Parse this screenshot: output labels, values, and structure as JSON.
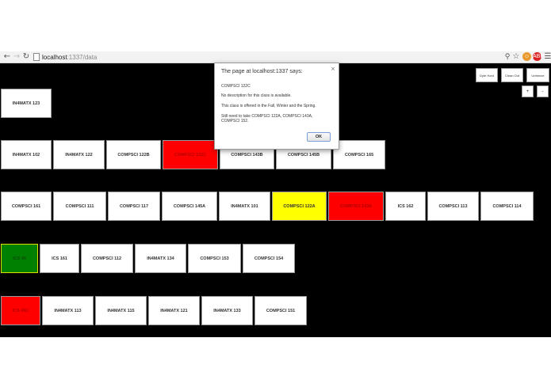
{
  "browser": {
    "url_host": "localhost",
    "url_rest": ":1337/data",
    "icons": [
      "back-icon",
      "forward-icon",
      "reload-icon",
      "page-icon",
      "zoom-icon",
      "star-icon",
      "extension-icon",
      "menu-icon"
    ],
    "ext_label": "ABP"
  },
  "controls": {
    "buttons": [
      "Dyte Hord",
      "Clean Out",
      "Unfreeze"
    ],
    "small_buttons": [
      "+",
      "-"
    ]
  },
  "rows": [
    {
      "courses": [
        {
          "label": "IN4MATX 123",
          "state": "normal"
        }
      ]
    },
    {
      "courses": [
        {
          "label": "IN4MATX 102",
          "state": "normal"
        },
        {
          "label": "IN4MATX 122",
          "state": "normal"
        },
        {
          "label": "COMPSCI 122B",
          "state": "normal"
        },
        {
          "label": "COMPSCI 122C",
          "state": "red"
        },
        {
          "label": "COMPSCI 143B",
          "state": "normal"
        },
        {
          "label": "COMPSCI 145B",
          "state": "normal"
        },
        {
          "label": "COMPSCI 165",
          "state": "normal"
        }
      ]
    },
    {
      "courses": [
        {
          "label": "COMPSCI 161",
          "state": "normal"
        },
        {
          "label": "COMPSCI 111",
          "state": "normal"
        },
        {
          "label": "COMPSCI 117",
          "state": "normal"
        },
        {
          "label": "COMPSCI 145A",
          "state": "normal"
        },
        {
          "label": "IN4MATX 101",
          "state": "normal"
        },
        {
          "label": "COMPSCI 122A",
          "state": "yellow"
        },
        {
          "label": "COMPSCI 143A",
          "state": "red"
        },
        {
          "label": "ICS 162",
          "state": "normal"
        },
        {
          "label": "COMPSCI 113",
          "state": "normal"
        },
        {
          "label": "COMPSCI 114",
          "state": "normal"
        }
      ]
    },
    {
      "courses": [
        {
          "label": "ICS 46",
          "state": "green"
        },
        {
          "label": "ICS 161",
          "state": "normal"
        },
        {
          "label": "COMPSCI 112",
          "state": "normal"
        },
        {
          "label": "IN4MATX 134",
          "state": "normal"
        },
        {
          "label": "COMPSCI 153",
          "state": "normal"
        },
        {
          "label": "COMPSCI 154",
          "state": "normal"
        }
      ]
    },
    {
      "courses": [
        {
          "label": "ICS 45C",
          "state": "red"
        },
        {
          "label": "IN4MATX 113",
          "state": "normal"
        },
        {
          "label": "IN4MATX 115",
          "state": "normal"
        },
        {
          "label": "IN4MATX 121",
          "state": "normal"
        },
        {
          "label": "IN4MATX 133",
          "state": "normal"
        },
        {
          "label": "COMPSCI 151",
          "state": "normal"
        }
      ]
    }
  ],
  "dialog": {
    "title": "The page at localhost:1337 says:",
    "course": "COMPSCI 122C",
    "description": "No description for this class is available.",
    "offered": "This class is offered in the Fall, Winter and the Spring.",
    "prereq": "Still need to take COMPSCI 122A, COMPSCI 143A, COMPSCI 152.",
    "ok_label": "OK"
  }
}
